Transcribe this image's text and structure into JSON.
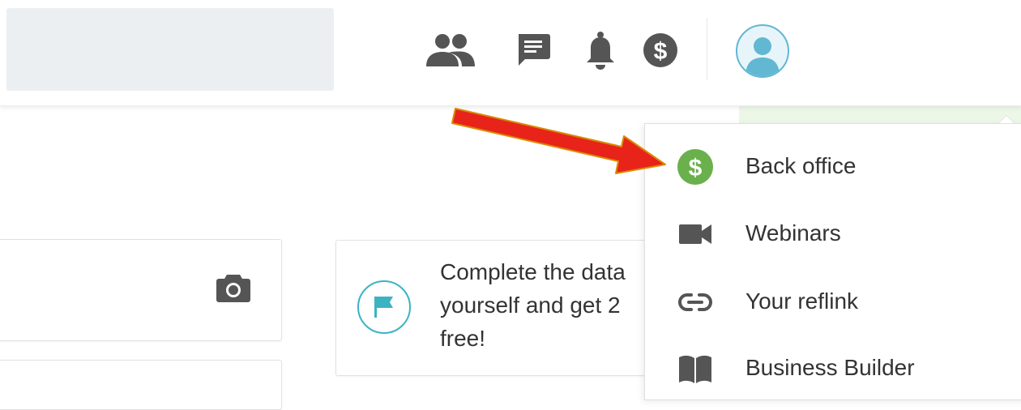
{
  "header": {
    "search_placeholder": "",
    "icons": [
      "users-icon",
      "chat-icon",
      "bell-icon",
      "dollar-icon"
    ],
    "avatar": "user-avatar-icon"
  },
  "card_message": {
    "text": "Complete the data\nyourself and get 2\nfree!"
  },
  "dropdown_menu": {
    "items": [
      {
        "label": "Back office",
        "icon": "dollar-circle-icon"
      },
      {
        "label": "Webinars",
        "icon": "video-camera-icon"
      },
      {
        "label": "Your reflink",
        "icon": "link-icon"
      },
      {
        "label": "Business Builder",
        "icon": "book-icon"
      }
    ]
  },
  "colors": {
    "icon_gray": "#555555",
    "green_accent": "#6ab04c",
    "teal_accent": "#3bb3c3",
    "avatar_blue": "#62b7d3",
    "arrow_red": "#e8231a"
  }
}
